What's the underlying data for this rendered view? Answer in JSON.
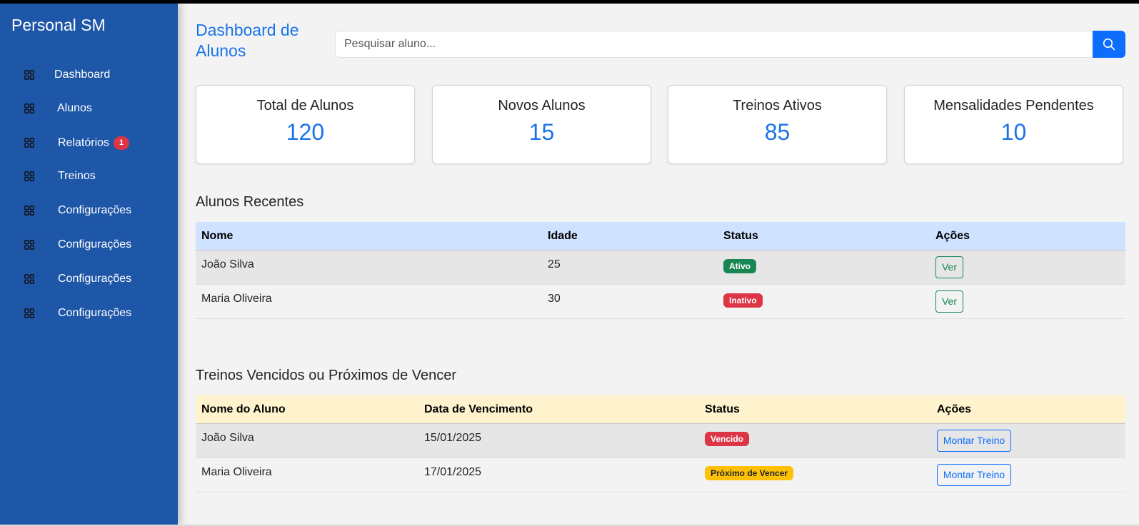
{
  "brand": "Personal SM",
  "sidebar": {
    "items": [
      {
        "label": "Dashboard"
      },
      {
        "label": "Alunos"
      },
      {
        "label": "Relatórios",
        "badge": "1"
      },
      {
        "label": "Treinos"
      },
      {
        "label": "Configurações"
      },
      {
        "label": "Configurações"
      },
      {
        "label": "Configurações"
      },
      {
        "label": "Configurações"
      }
    ]
  },
  "header": {
    "title": "Dashboard de Alunos",
    "search_placeholder": "Pesquisar aluno...",
    "search_icon": "search-icon"
  },
  "stats": [
    {
      "title": "Total de Alunos",
      "value": "120"
    },
    {
      "title": "Novos Alunos",
      "value": "15"
    },
    {
      "title": "Treinos Ativos",
      "value": "85"
    },
    {
      "title": "Mensalidades Pendentes",
      "value": "10"
    }
  ],
  "recent": {
    "title": "Alunos Recentes",
    "columns": [
      "Nome",
      "Idade",
      "Status",
      "Ações"
    ],
    "rows": [
      {
        "name": "João Silva",
        "age": "25",
        "status": "Ativo",
        "status_color": "#198754",
        "action": "Ver"
      },
      {
        "name": "Maria Oliveira",
        "age": "30",
        "status": "Inativo",
        "status_color": "#dc3545",
        "action": "Ver"
      }
    ]
  },
  "expiring": {
    "title": "Treinos Vencidos ou Próximos de Vencer",
    "columns": [
      "Nome do Aluno",
      "Data de Vencimento",
      "Status",
      "Ações"
    ],
    "rows": [
      {
        "name": "João Silva",
        "date": "15/01/2025",
        "status": "Vencido",
        "status_color": "#dc3545",
        "action": "Montar Treino"
      },
      {
        "name": "Maria Oliveira",
        "date": "17/01/2025",
        "status": "Próximo de Vencer",
        "status_color": "#ffc107",
        "action": "Montar Treino"
      }
    ]
  },
  "colors": {
    "sidebar": "#1e56a8",
    "accent": "#1a73e8",
    "recent_header": "#cfe2ff",
    "expiring_header": "#fff3cd"
  }
}
